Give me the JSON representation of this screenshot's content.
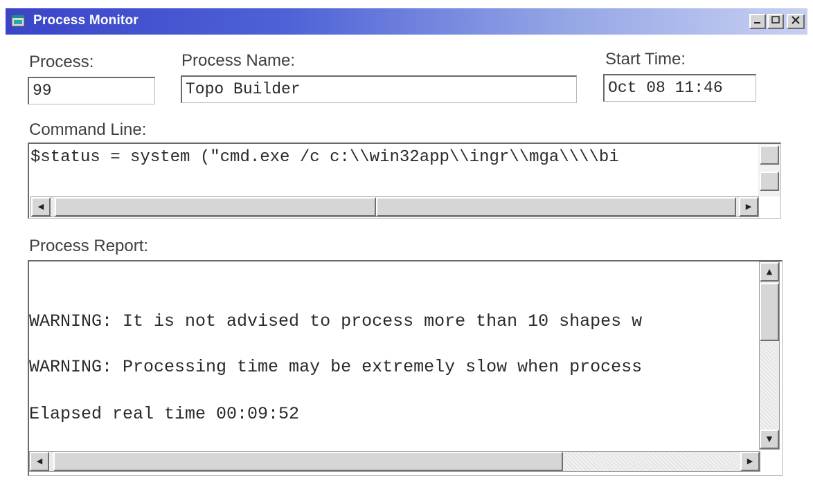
{
  "window": {
    "title": "Process Monitor",
    "icon": "app-window-icon",
    "controls": {
      "minimize": "minimize-icon",
      "maximize": "maximize-icon",
      "close": "close-icon"
    },
    "titlebar_colors": [
      "#3a44c8",
      "#c8d0f2"
    ]
  },
  "process": {
    "label": "Process:",
    "value": "99"
  },
  "process_name": {
    "label": "Process Name:",
    "value": "Topo Builder"
  },
  "start_time": {
    "label": "Start Time:",
    "value": "Oct 08 11:46"
  },
  "command_line": {
    "label": "Command Line:",
    "value": "$status = system (\"cmd.exe /c c:\\\\win32app\\\\ingr\\\\mga\\\\\\\\bi"
  },
  "process_report": {
    "label": "Process Report:",
    "lines": [
      "WARNING: It is not advised to process more than 10 shapes w",
      "WARNING: Processing time may be extremely slow when process",
      "Elapsed real time    00:09:52"
    ]
  }
}
